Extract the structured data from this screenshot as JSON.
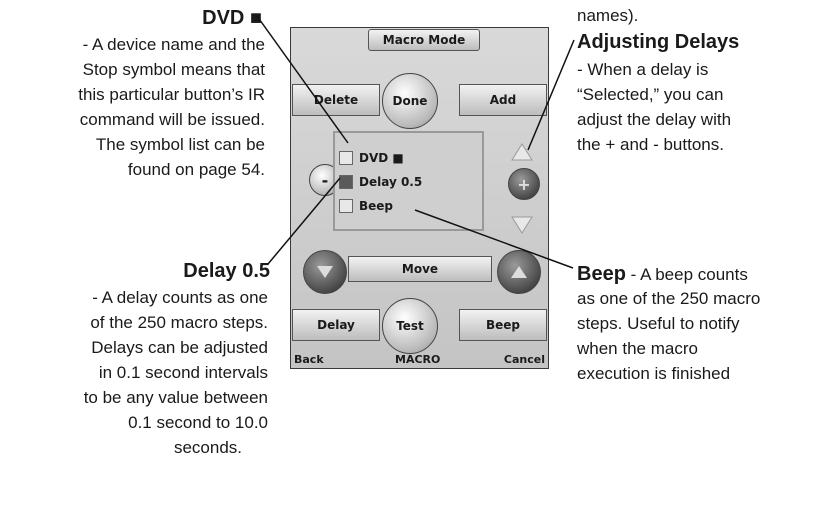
{
  "left_top": {
    "heading": "DVD ■",
    "lines": [
      "- A device name and the",
      "Stop symbol means that",
      "this particular button’s IR",
      "command will be issued.",
      "The symbol list can be",
      "found on page 54."
    ]
  },
  "left_bottom": {
    "heading": "Delay 0.5",
    "lines": [
      "- A delay counts as one",
      "of the 250 macro steps.",
      "Delays can be adjusted",
      "in 0.1 second intervals",
      "to be any value between",
      "0.1 second to 10.0",
      "seconds."
    ]
  },
  "right_top": {
    "prev": "names).",
    "heading": "Adjusting Delays",
    "lines": [
      "- When a delay is",
      "“Selected,” you can",
      "adjust the delay with",
      "the + and - buttons."
    ]
  },
  "right_bottom": {
    "heading": "Beep",
    "first_rest": " - A beep counts",
    "lines": [
      "as one of the 250 macro",
      "steps. Useful to notify",
      "when the macro",
      "execution is finished"
    ]
  },
  "device": {
    "title": "Macro Mode",
    "delete": "Delete",
    "done": "Done",
    "add": "Add",
    "minus": "-",
    "plus": "+",
    "items": [
      "DVD ■",
      "Delay 0.5",
      "Beep"
    ],
    "move": "Move",
    "delay": "Delay",
    "test": "Test",
    "beep": "Beep",
    "back": "Back",
    "macro": "MACRO",
    "cancel": "Cancel"
  }
}
